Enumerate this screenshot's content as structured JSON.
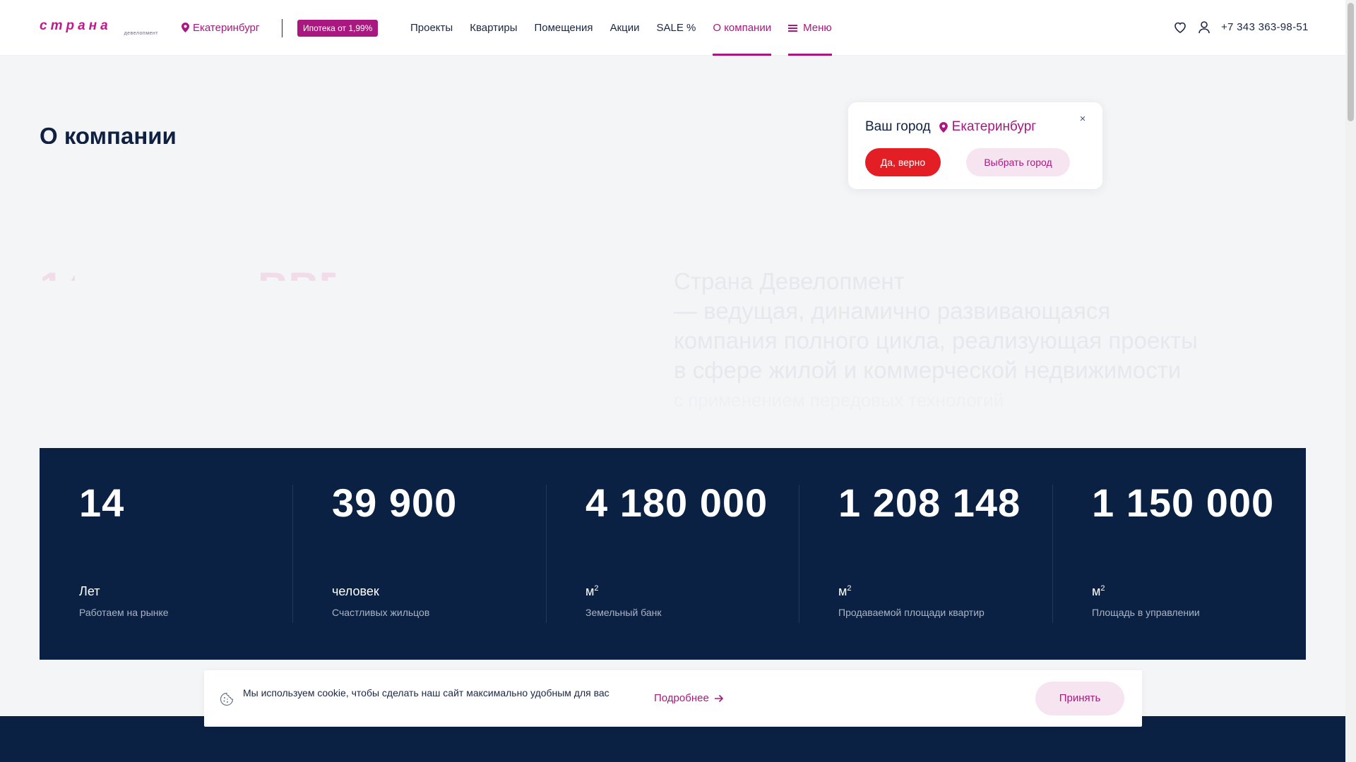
{
  "header": {
    "logo_text": "страна",
    "logo_subtext": "девелопмент",
    "city": "Екатеринбург",
    "mortgage_badge": "Ипотека от 1,99%",
    "nav": [
      {
        "label": "Проекты"
      },
      {
        "label": "Квартиры"
      },
      {
        "label": "Помещения"
      },
      {
        "label": "Акции"
      },
      {
        "label": "SALE %"
      },
      {
        "label": "О компании"
      },
      {
        "label": "Меню"
      }
    ],
    "phone": "+7 343 363-98-51",
    "icons": [
      "heart-icon",
      "user-icon",
      "location-pin-icon",
      "menu-icon"
    ]
  },
  "page": {
    "title": "О компании",
    "hero_text_a": "Страна Девелопмент",
    "hero_text_b": " — ведущая, динамично развивающаяся",
    "hero_text_c": "компания полного цикла, реализующая проекты",
    "hero_text_d": "в сфере жилой и коммерческой недвижимости",
    "hero_text_e": "с применением передовых технологий"
  },
  "city_popup": {
    "question": "Ваш город",
    "city": "Екатеринбург",
    "confirm_label": "Да, верно",
    "choose_label": "Выбрать город"
  },
  "stats": [
    {
      "value": "14",
      "unit": "Лет",
      "unit_sup": "",
      "desc": "Работаем на рынке"
    },
    {
      "value": "39 900",
      "unit": "человек",
      "unit_sup": "",
      "desc": "Счастливых жильцов"
    },
    {
      "value": "4 180 000",
      "unit": "м",
      "unit_sup": "2",
      "desc": "Земельный банк"
    },
    {
      "value": "1 208 148",
      "unit": "м",
      "unit_sup": "2",
      "desc": "Продаваемой площади квартир"
    },
    {
      "value": "1 150 000",
      "unit": "м",
      "unit_sup": "2",
      "desc": "Площадь в управлении"
    }
  ],
  "cookie": {
    "text": "Мы используем cookie, чтобы сделать наш сайт максимально удобным для вас",
    "more_label": "Подробнее",
    "accept_label": "Принять"
  },
  "colors": {
    "brand": "#a8187f",
    "accent_red": "#e31e24",
    "navy": "#0b2143"
  }
}
